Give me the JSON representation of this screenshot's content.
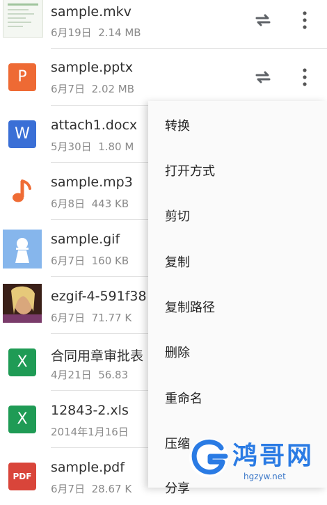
{
  "files": [
    {
      "name": "sample.mkv",
      "date": "6月19日",
      "size": "2.14 MB",
      "icon": "video-thumbnail",
      "synced": true
    },
    {
      "name": "sample.pptx",
      "date": "6月7日",
      "size": "2.02 MB",
      "icon": "pptx-icon",
      "tile_letter": "P",
      "tile_color": "#ee6a34",
      "synced": true
    },
    {
      "name": "attach1.docx",
      "date": "5月30日",
      "size": "1.80 M",
      "icon": "docx-icon",
      "tile_letter": "W",
      "tile_color": "#3a6fd6"
    },
    {
      "name": "sample.mp3",
      "date": "6月8日",
      "size": "443 KB",
      "icon": "music-icon",
      "tile_color": "#ef6c35"
    },
    {
      "name": "sample.gif",
      "date": "6月7日",
      "size": "160 KB",
      "icon": "image-gif-icon",
      "tile_color": "#86b6ec"
    },
    {
      "name": "ezgif-4-591f38",
      "date": "6月7日",
      "size": "71.77 K",
      "icon": "photo-thumbnail"
    },
    {
      "name": "合同用章审批表",
      "date": "4月21日",
      "size": "56.83",
      "icon": "xlsx-icon",
      "tile_letter": "X",
      "tile_color": "#1f9b55"
    },
    {
      "name": "12843-2.xls",
      "date": "2014年1月16日",
      "size": "",
      "icon": "xls-icon",
      "tile_letter": "X",
      "tile_color": "#1f9b55"
    },
    {
      "name": "sample.pdf",
      "date": "6月7日",
      "size": "28.67 K",
      "icon": "pdf-icon",
      "tile_letter": "PDF",
      "tile_color": "#d9453a"
    }
  ],
  "context_menu": [
    "转换",
    "打开方式",
    "剪切",
    "复制",
    "复制路径",
    "删除",
    "重命名",
    "压缩",
    "分享"
  ],
  "watermark": {
    "text": "鸿哥网",
    "url": "hgzyw.net",
    "color": "#2a7be4"
  }
}
